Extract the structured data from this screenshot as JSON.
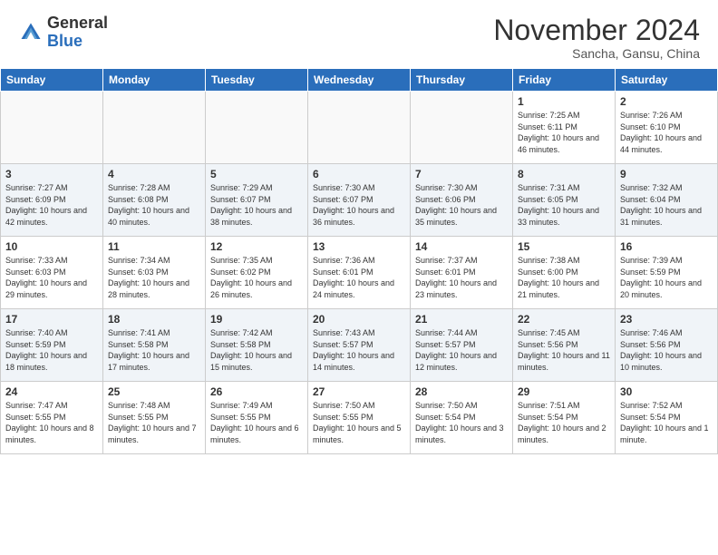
{
  "header": {
    "logo_general": "General",
    "logo_blue": "Blue",
    "month_title": "November 2024",
    "location": "Sancha, Gansu, China"
  },
  "weekdays": [
    "Sunday",
    "Monday",
    "Tuesday",
    "Wednesday",
    "Thursday",
    "Friday",
    "Saturday"
  ],
  "weeks": [
    [
      {
        "day": "",
        "empty": true
      },
      {
        "day": "",
        "empty": true
      },
      {
        "day": "",
        "empty": true
      },
      {
        "day": "",
        "empty": true
      },
      {
        "day": "",
        "empty": true
      },
      {
        "day": "1",
        "sunrise": "7:25 AM",
        "sunset": "6:11 PM",
        "daylight": "10 hours and 46 minutes."
      },
      {
        "day": "2",
        "sunrise": "7:26 AM",
        "sunset": "6:10 PM",
        "daylight": "10 hours and 44 minutes."
      }
    ],
    [
      {
        "day": "3",
        "sunrise": "7:27 AM",
        "sunset": "6:09 PM",
        "daylight": "10 hours and 42 minutes."
      },
      {
        "day": "4",
        "sunrise": "7:28 AM",
        "sunset": "6:08 PM",
        "daylight": "10 hours and 40 minutes."
      },
      {
        "day": "5",
        "sunrise": "7:29 AM",
        "sunset": "6:07 PM",
        "daylight": "10 hours and 38 minutes."
      },
      {
        "day": "6",
        "sunrise": "7:30 AM",
        "sunset": "6:07 PM",
        "daylight": "10 hours and 36 minutes."
      },
      {
        "day": "7",
        "sunrise": "7:30 AM",
        "sunset": "6:06 PM",
        "daylight": "10 hours and 35 minutes."
      },
      {
        "day": "8",
        "sunrise": "7:31 AM",
        "sunset": "6:05 PM",
        "daylight": "10 hours and 33 minutes."
      },
      {
        "day": "9",
        "sunrise": "7:32 AM",
        "sunset": "6:04 PM",
        "daylight": "10 hours and 31 minutes."
      }
    ],
    [
      {
        "day": "10",
        "sunrise": "7:33 AM",
        "sunset": "6:03 PM",
        "daylight": "10 hours and 29 minutes."
      },
      {
        "day": "11",
        "sunrise": "7:34 AM",
        "sunset": "6:03 PM",
        "daylight": "10 hours and 28 minutes."
      },
      {
        "day": "12",
        "sunrise": "7:35 AM",
        "sunset": "6:02 PM",
        "daylight": "10 hours and 26 minutes."
      },
      {
        "day": "13",
        "sunrise": "7:36 AM",
        "sunset": "6:01 PM",
        "daylight": "10 hours and 24 minutes."
      },
      {
        "day": "14",
        "sunrise": "7:37 AM",
        "sunset": "6:01 PM",
        "daylight": "10 hours and 23 minutes."
      },
      {
        "day": "15",
        "sunrise": "7:38 AM",
        "sunset": "6:00 PM",
        "daylight": "10 hours and 21 minutes."
      },
      {
        "day": "16",
        "sunrise": "7:39 AM",
        "sunset": "5:59 PM",
        "daylight": "10 hours and 20 minutes."
      }
    ],
    [
      {
        "day": "17",
        "sunrise": "7:40 AM",
        "sunset": "5:59 PM",
        "daylight": "10 hours and 18 minutes."
      },
      {
        "day": "18",
        "sunrise": "7:41 AM",
        "sunset": "5:58 PM",
        "daylight": "10 hours and 17 minutes."
      },
      {
        "day": "19",
        "sunrise": "7:42 AM",
        "sunset": "5:58 PM",
        "daylight": "10 hours and 15 minutes."
      },
      {
        "day": "20",
        "sunrise": "7:43 AM",
        "sunset": "5:57 PM",
        "daylight": "10 hours and 14 minutes."
      },
      {
        "day": "21",
        "sunrise": "7:44 AM",
        "sunset": "5:57 PM",
        "daylight": "10 hours and 12 minutes."
      },
      {
        "day": "22",
        "sunrise": "7:45 AM",
        "sunset": "5:56 PM",
        "daylight": "10 hours and 11 minutes."
      },
      {
        "day": "23",
        "sunrise": "7:46 AM",
        "sunset": "5:56 PM",
        "daylight": "10 hours and 10 minutes."
      }
    ],
    [
      {
        "day": "24",
        "sunrise": "7:47 AM",
        "sunset": "5:55 PM",
        "daylight": "10 hours and 8 minutes."
      },
      {
        "day": "25",
        "sunrise": "7:48 AM",
        "sunset": "5:55 PM",
        "daylight": "10 hours and 7 minutes."
      },
      {
        "day": "26",
        "sunrise": "7:49 AM",
        "sunset": "5:55 PM",
        "daylight": "10 hours and 6 minutes."
      },
      {
        "day": "27",
        "sunrise": "7:50 AM",
        "sunset": "5:55 PM",
        "daylight": "10 hours and 5 minutes."
      },
      {
        "day": "28",
        "sunrise": "7:50 AM",
        "sunset": "5:54 PM",
        "daylight": "10 hours and 3 minutes."
      },
      {
        "day": "29",
        "sunrise": "7:51 AM",
        "sunset": "5:54 PM",
        "daylight": "10 hours and 2 minutes."
      },
      {
        "day": "30",
        "sunrise": "7:52 AM",
        "sunset": "5:54 PM",
        "daylight": "10 hours and 1 minute."
      }
    ]
  ]
}
